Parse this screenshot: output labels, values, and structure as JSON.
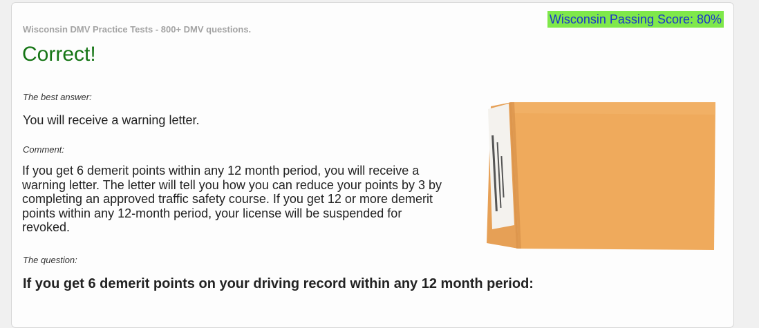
{
  "header": {
    "site_title": "Wisconsin DMV Practice Tests - 800+ DMV questions.",
    "passing_score": "Wisconsin Passing Score: 80%"
  },
  "result": {
    "heading": "Correct!",
    "best_answer_label": "The best answer:",
    "best_answer": "You will receive a warning letter.",
    "comment_label": "Comment:",
    "comment": "If you get 6 demerit points within any 12 month period, you will receive a warning letter. The letter will tell you how you can reduce your points by 3 by completing an approved traffic safety course. If you get 12 or more demerit points within any 12-month period, your license will be suspended for revoked.",
    "question_label": "The question:",
    "question": "If you get 6 demerit points on your driving record within any 12 month period:"
  },
  "image": {
    "subject": "manila envelope from the Division of Motor Vehicles",
    "colors": {
      "envelope": "#efaa5c",
      "flap_shadow": "#d9924a",
      "label": "#f4f2ee"
    }
  },
  "colors": {
    "badge_bg": "#7fe84a",
    "badge_text": "#1b35c9",
    "correct_green": "#157515"
  }
}
